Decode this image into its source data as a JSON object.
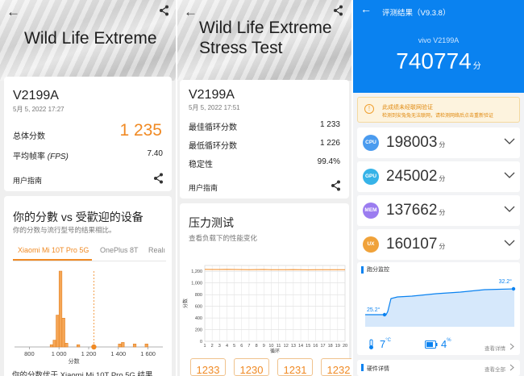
{
  "panel1": {
    "hero_title": "Wild Life Extreme",
    "device": "V2199A",
    "date": "5月 5, 2022 17:27",
    "total_label": "总体分数",
    "total_score": "1 235",
    "fps_label_main": "平均帧率",
    "fps_label_unit": "(FPS)",
    "fps_value": "7.40",
    "guide": "用户指南",
    "compare_title": "你的分數 vs 受歡迎的设备",
    "compare_subtitle": "你的分数与流行型号的结果相比。",
    "tabs": [
      {
        "label": "Xiaomi Mi 10T Pro 5G",
        "active": true
      },
      {
        "label": "OnePlus 8T",
        "active": false
      },
      {
        "label": "Realı",
        "active": false
      }
    ],
    "histogram": {
      "xlabel": "分数",
      "xticks": [
        "800",
        "1 000",
        "1 200",
        "1 400",
        "1 600"
      ],
      "xtick_values": [
        800,
        1000,
        1200,
        1400,
        1600
      ],
      "bins": [
        {
          "x": 950,
          "v": 0.03
        },
        {
          "x": 970,
          "v": 0.09
        },
        {
          "x": 990,
          "v": 0.42
        },
        {
          "x": 1010,
          "v": 1.0
        },
        {
          "x": 1030,
          "v": 0.38
        },
        {
          "x": 1050,
          "v": 0.05
        },
        {
          "x": 1130,
          "v": 0.03
        },
        {
          "x": 1410,
          "v": 0.04
        },
        {
          "x": 1430,
          "v": 0.06
        },
        {
          "x": 1510,
          "v": 0.04
        },
        {
          "x": 1590,
          "v": 0.04
        }
      ],
      "marker_value": 1235,
      "xlim": [
        700,
        1700
      ]
    },
    "bottom_text": "你的分数优于 Xiaomi Mi 10T Pro 5G 结果",
    "colors": {
      "accent": "#f08a24",
      "bar": "#f5a656",
      "bar_edge": "#e07a18"
    }
  },
  "panel2": {
    "hero_title": "Wild Life Extreme Stress Test",
    "device": "V2199A",
    "date": "5月 5, 2022 17:51",
    "rows": [
      {
        "label": "最佳循环分数",
        "value": "1 233"
      },
      {
        "label": "最低循环分数",
        "value": "1 226"
      },
      {
        "label": "稳定性",
        "value": "99.4%"
      }
    ],
    "guide": "用户指南",
    "stress_title": "压力测试",
    "stress_subtitle": "查看负载下的性能变化",
    "chart_data": {
      "type": "line",
      "ylabel": "分数",
      "xlabel": "循环",
      "y_ticks": [
        "0",
        "200",
        "400",
        "600",
        "800",
        "1,000",
        "1,200"
      ],
      "y_tick_values": [
        0,
        200,
        400,
        600,
        800,
        1000,
        1200
      ],
      "x_ticks": [
        "1",
        "2",
        "3",
        "4",
        "5",
        "6",
        "7",
        "8",
        "9",
        "10",
        "11",
        "12",
        "13",
        "14",
        "15",
        "16",
        "17",
        "18",
        "19",
        "20"
      ],
      "ylim": [
        0,
        1300
      ],
      "x": [
        1,
        2,
        3,
        4,
        5,
        6,
        7,
        8,
        9,
        10,
        11,
        12,
        13,
        14,
        15,
        16,
        17,
        18,
        19,
        20
      ],
      "values": [
        1233,
        1230,
        1231,
        1232,
        1230,
        1229,
        1228,
        1229,
        1230,
        1228,
        1227,
        1228,
        1229,
        1227,
        1226,
        1228,
        1227,
        1227,
        1228,
        1227
      ],
      "grid": true,
      "color": "#f08a24"
    },
    "loop_scores": [
      "1233",
      "1230",
      "1231",
      "1232"
    ]
  },
  "panel3": {
    "title": "评测结果（V9.3.8）",
    "device": "vivo V2199A",
    "total": "740774",
    "total_unit": "分",
    "warning_line1": "此成绩未经联网验证",
    "warning_line2": "检测到安兔兔无法联网，请检测网络后点击重新验证",
    "subs": [
      {
        "icon": "CPU",
        "score": "198003",
        "unit": "分",
        "color": "#4a9bef"
      },
      {
        "icon": "GPU",
        "score": "245002",
        "unit": "分",
        "color": "#36b3e8"
      },
      {
        "icon": "MEM",
        "score": "137662",
        "unit": "分",
        "color": "#9b7cf0"
      },
      {
        "icon": "UX",
        "score": "160107",
        "unit": "分",
        "color": "#f0a23a"
      }
    ],
    "temp_title": "跑分监控",
    "temp_min": "25.2°",
    "temp_max": "32.2°",
    "temp_delta": "7",
    "temp_delta_unit": "°C",
    "batt_delta": "4",
    "batt_delta_unit": "%",
    "detail_link": "查看详情",
    "hw_title": "硬件详情",
    "hw_link": "查看全部",
    "colors": {
      "primary": "#0a82f0"
    }
  }
}
